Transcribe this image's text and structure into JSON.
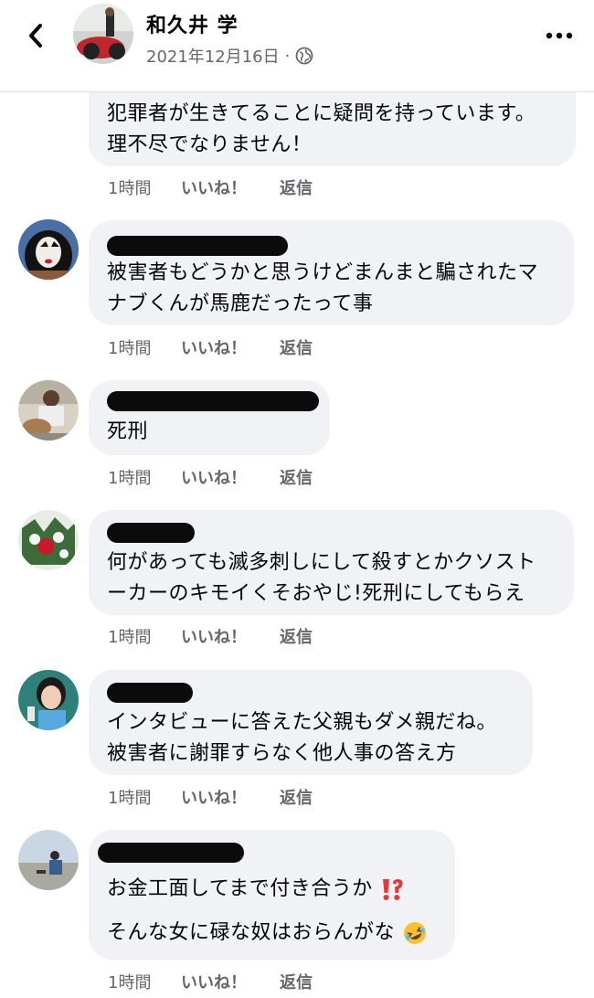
{
  "header": {
    "poster_name": "和久井 学",
    "date": "2021年12月16日",
    "separator": "·",
    "icons": {
      "back": "chevron-left-icon",
      "privacy": "globe-icon",
      "more": "more-dots-icon"
    }
  },
  "comments": [
    {
      "text_lines": [
        "犯罪者が生きてることに疑問を持っています。",
        "理不尽でなりません！"
      ],
      "time": "1時間",
      "like": "いいね！",
      "reply": "返信"
    },
    {
      "text_lines": [
        "被害者もどうかと思うけどまんまと騙されたマ",
        "ナブくんが馬鹿だったって事"
      ],
      "time": "1時間",
      "like": "いいね！",
      "reply": "返信"
    },
    {
      "text_lines": [
        "死刑"
      ],
      "time": "1時間",
      "like": "いいね！",
      "reply": "返信"
    },
    {
      "text_lines": [
        "何があっても滅多刺しにして殺すとかクソスト",
        "ーカーのキモイくそおやじ!死刑にしてもらえ"
      ],
      "time": "1時間",
      "like": "いいね！",
      "reply": "返信"
    },
    {
      "text_lines": [
        "インタビューに答えた父親もダメ親だね。",
        "被害者に謝罪すらなく他人事の答え方"
      ],
      "time": "1時間",
      "like": "いいね！",
      "reply": "返信"
    },
    {
      "text_lines": [
        "お金工面してまで付き合うか",
        "そんな女に碌な奴はおらんがな"
      ],
      "emoji": [
        "double-exclamation-icon",
        "rofl-emoji-icon"
      ],
      "time": "1時間",
      "like": "いいね！",
      "reply": "返信"
    }
  ],
  "colors": {
    "bubble": "#f0f2f5",
    "meta": "#65676b",
    "text": "#050505",
    "redaction": "#0b0b0b"
  }
}
